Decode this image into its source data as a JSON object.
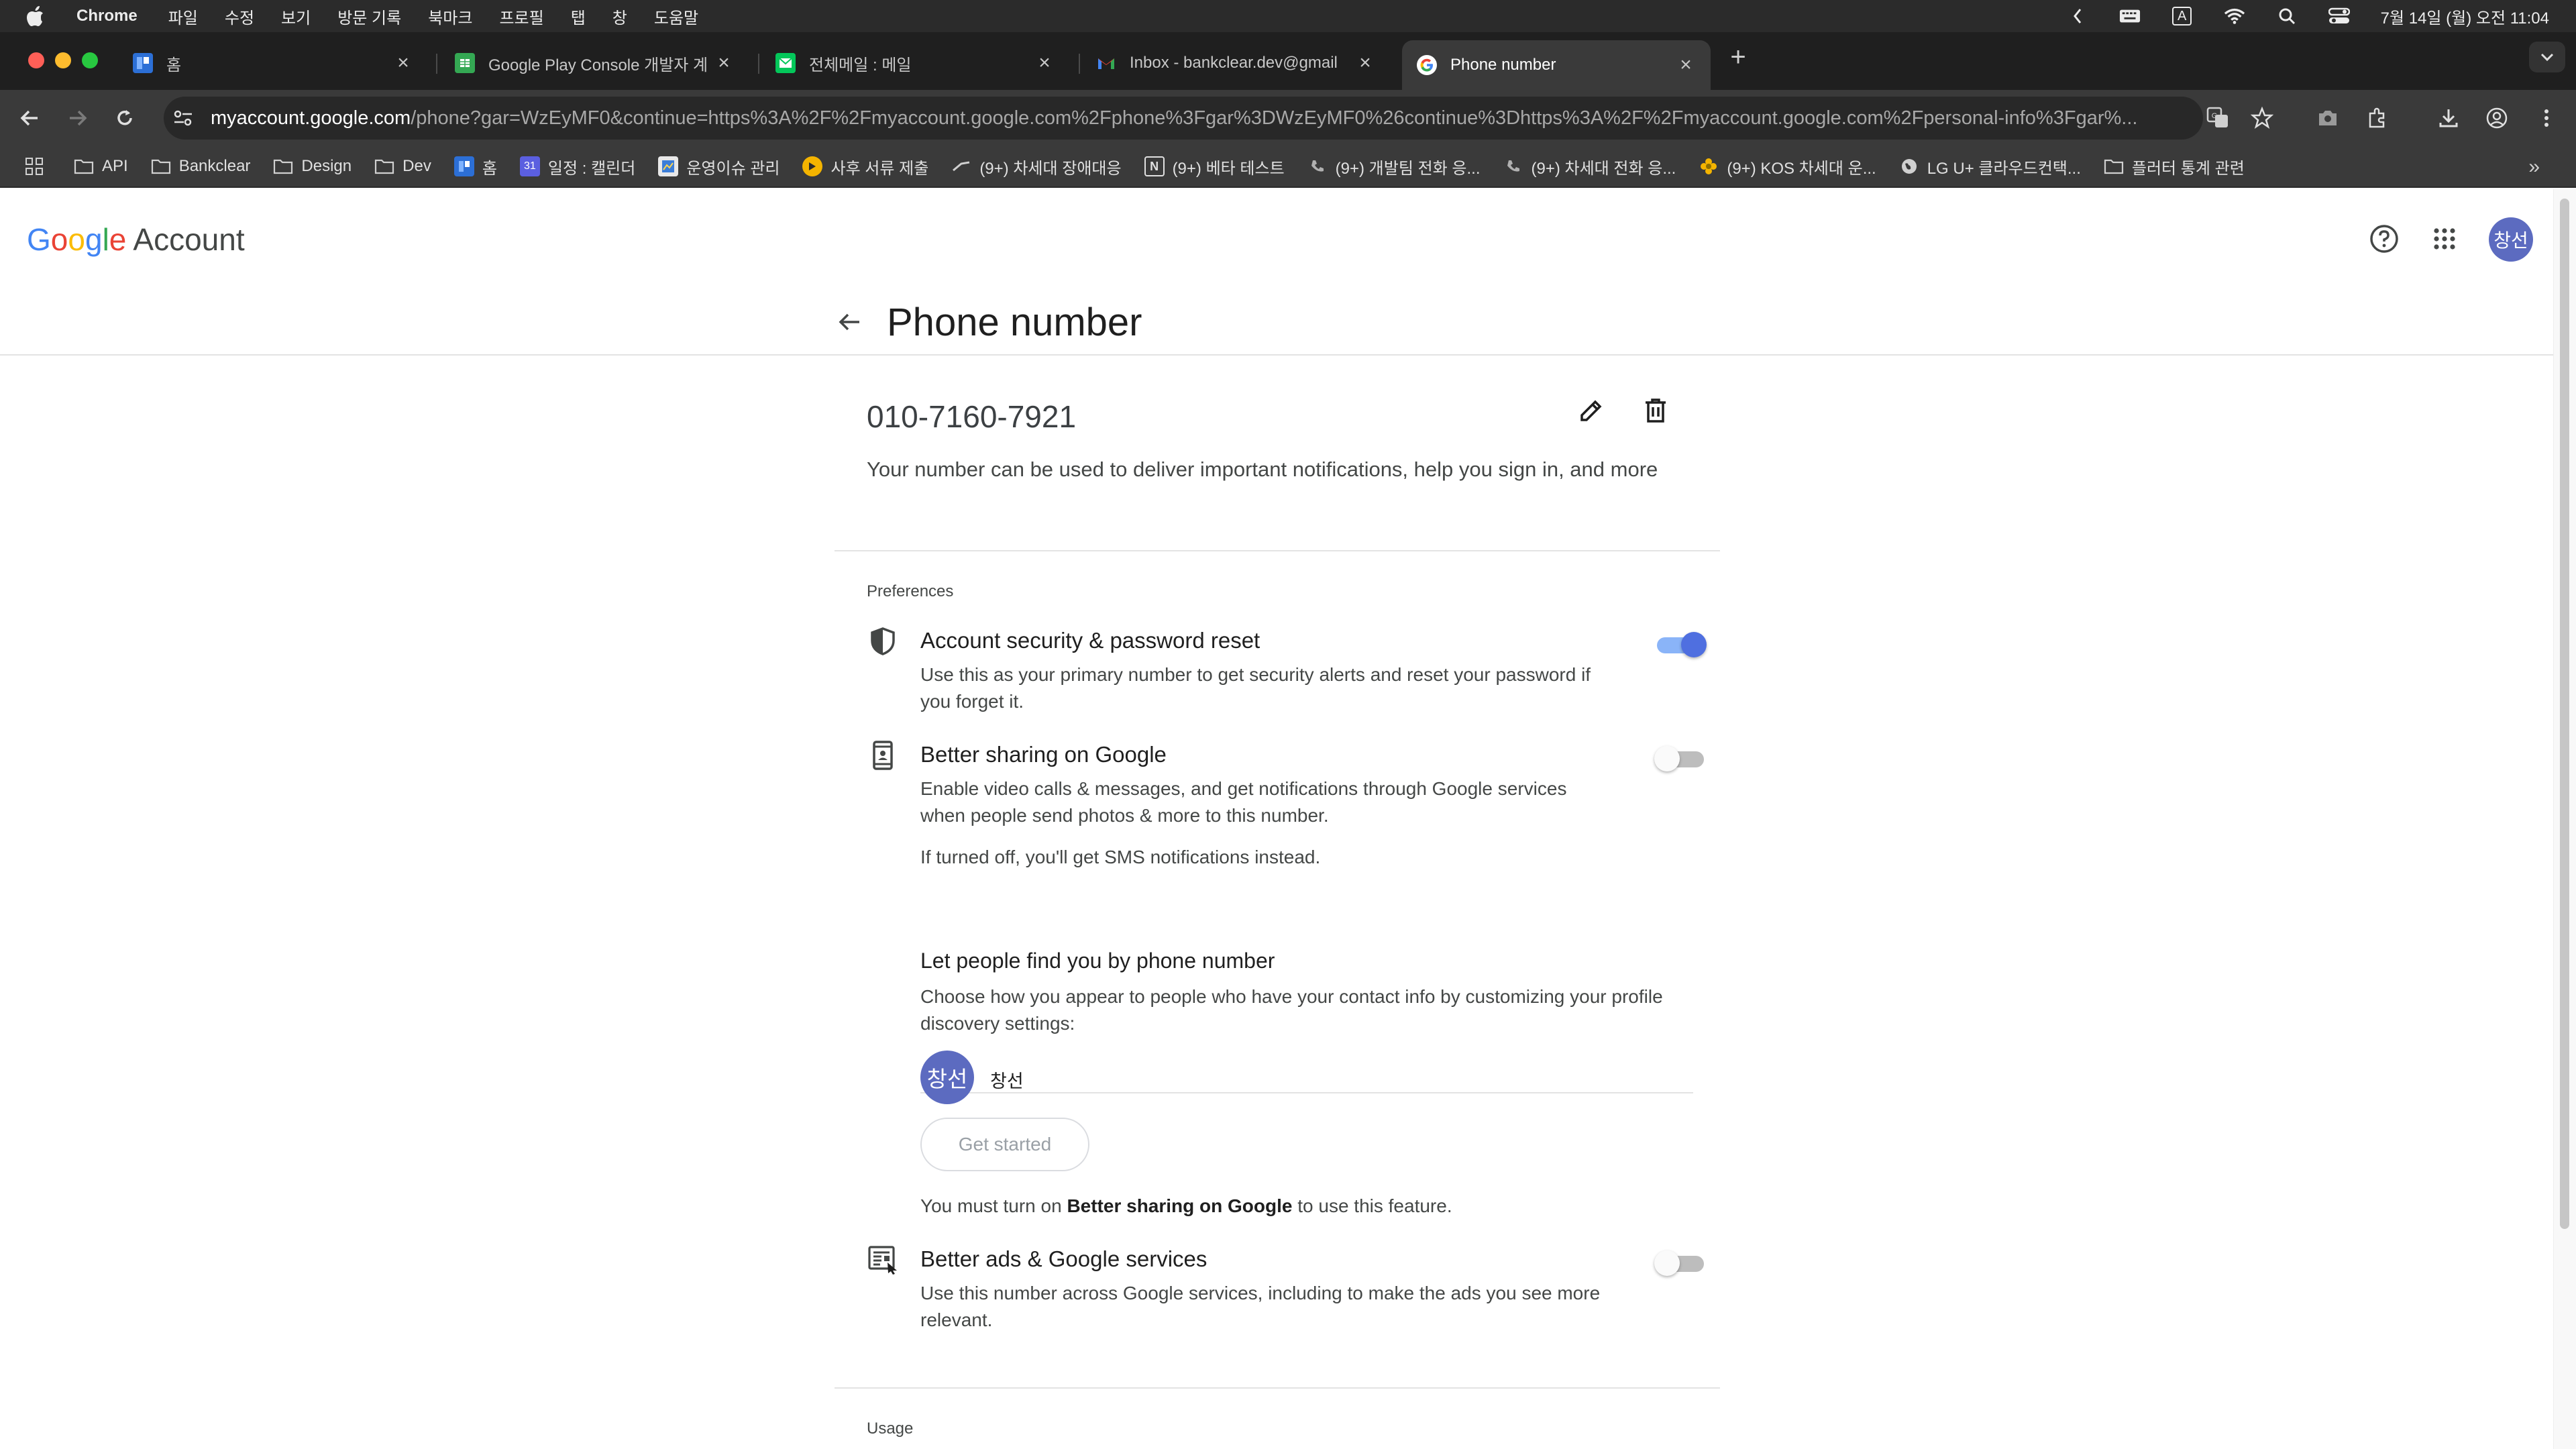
{
  "menubar": {
    "app": "Chrome",
    "items": [
      "파일",
      "수정",
      "보기",
      "방문 기록",
      "북마크",
      "프로필",
      "탭",
      "창",
      "도움말"
    ],
    "input_indicator": "A",
    "datetime": "7월 14일 (월) 오전 11:04"
  },
  "tabs": [
    {
      "title": "홈",
      "favicon": "confluence-icon",
      "color": "#2c6fd6"
    },
    {
      "title": "Google Play Console 개발자 계",
      "favicon": "sheets-icon",
      "color": "#34a853"
    },
    {
      "title": "전체메일 : 메일",
      "favicon": "mail-icon",
      "color": "#03c75a"
    },
    {
      "title": "Inbox - bankclear.dev@gmail",
      "favicon": "gmail-icon",
      "color": "#ea4335"
    },
    {
      "title": "Phone number",
      "favicon": "google-icon",
      "color": "#ffffff"
    }
  ],
  "address": {
    "host": "myaccount.google.com",
    "path": "/phone?gar=WzEyMF0&continue=https%3A%2F%2Fmyaccount.google.com%2Fphone%3Fgar%3DWzEyMF0%26continue%3Dhttps%3A%2F%2Fmyaccount.google.com%2Fpersonal-info%3Fgar%..."
  },
  "bookmarks": [
    {
      "label": "API",
      "icon": "folder-icon"
    },
    {
      "label": "Bankclear",
      "icon": "folder-icon"
    },
    {
      "label": "Design",
      "icon": "folder-icon"
    },
    {
      "label": "Dev",
      "icon": "folder-icon"
    },
    {
      "label": "홈",
      "icon": "confluence-icon"
    },
    {
      "label": "일정 : 캘린더",
      "icon": "calendar-icon"
    },
    {
      "label": "운영이슈 관리",
      "icon": "sheet-icon"
    },
    {
      "label": "사후 서류 제출",
      "icon": "document-icon"
    },
    {
      "label": "(9+) 차세대 장애대응",
      "icon": "slack-icon"
    },
    {
      "label": "(9+) 베타 테스트",
      "icon": "notion-icon"
    },
    {
      "label": "(9+) 개발팀 전화 응...",
      "icon": "phone-icon"
    },
    {
      "label": "(9+) 차세대 전화 응...",
      "icon": "phone-icon"
    },
    {
      "label": "(9+) KOS 차세대 운...",
      "icon": "flower-icon"
    },
    {
      "label": "LG U+ 클라우드컨택...",
      "icon": "globe-icon"
    },
    {
      "label": "플러터 통계 관련",
      "icon": "folder-icon"
    }
  ],
  "header": {
    "logo_letters": [
      "G",
      "o",
      "o",
      "g",
      "l",
      "e"
    ],
    "logo_colors": [
      "#4285f4",
      "#ea4335",
      "#fbbc05",
      "#4285f4",
      "#34a853",
      "#ea4335"
    ],
    "logo_suffix": "Account",
    "avatar": "창선"
  },
  "page": {
    "title": "Phone number",
    "phone": "010-7160-7921",
    "phone_description": "Your number can be used to deliver important notifications, help you sign in, and more"
  },
  "preferences": {
    "label": "Preferences",
    "security": {
      "title": "Account security & password reset",
      "description": "Use this as your primary number to get security alerts and reset your password if you forget it.",
      "enabled": true
    },
    "sharing": {
      "title": "Better sharing on Google",
      "description": "Enable video calls & messages, and get notifications through Google services when people send photos & more to this number.",
      "note": "If turned off, you'll get SMS notifications instead.",
      "enabled": false
    },
    "find": {
      "title": "Let people find you by phone number",
      "description": "Choose how you appear to people who have your contact info by customizing your profile discovery settings:",
      "avatar": "창선",
      "name": "창선",
      "button": "Get started",
      "must_prefix": "You must turn on ",
      "must_bold": "Better sharing on Google",
      "must_suffix": " to use this feature."
    },
    "ads": {
      "title": "Better ads & Google services",
      "description": "Use this number across Google services, including to make the ads you see more relevant.",
      "enabled": false
    }
  },
  "usage": {
    "label": "Usage"
  }
}
